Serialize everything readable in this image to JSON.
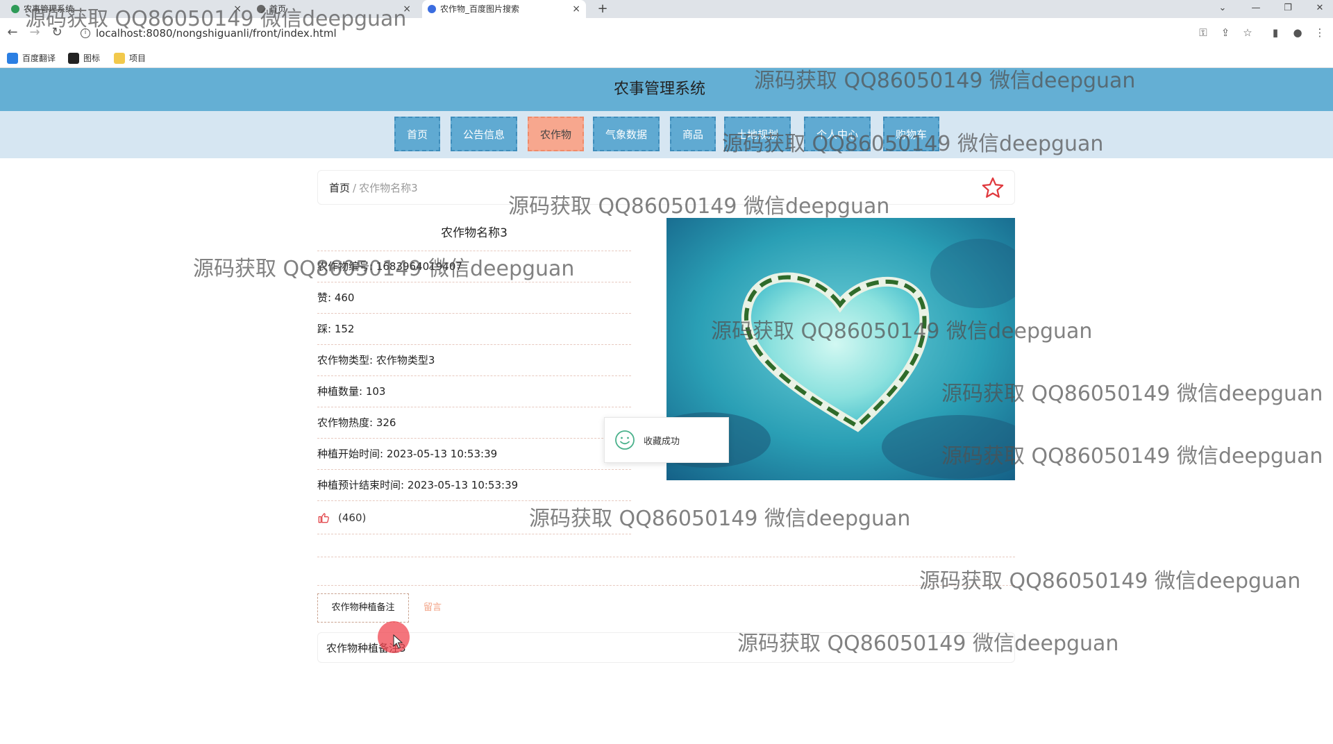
{
  "browser": {
    "tabs": [
      {
        "title": "农事管理系统"
      },
      {
        "title": "首页"
      },
      {
        "title": "农作物_百度图片搜索"
      }
    ],
    "url": "localhost:8080/nongshiguanli/front/index.html",
    "bookmarks": [
      {
        "label": "百度翻译"
      },
      {
        "label": "图标"
      },
      {
        "label": "项目"
      }
    ]
  },
  "site": {
    "title": "农事管理系统",
    "nav": [
      {
        "label": "首页"
      },
      {
        "label": "公告信息"
      },
      {
        "label": "农作物",
        "active": true
      },
      {
        "label": "气象数据"
      },
      {
        "label": "商品"
      },
      {
        "label": "土地规划"
      },
      {
        "label": "个人中心"
      },
      {
        "label": "购物车"
      }
    ]
  },
  "breadcrumb": {
    "home": "首页",
    "separator": "/",
    "current": "农作物名称3"
  },
  "detail": {
    "title": "农作物名称3",
    "rows": [
      {
        "label": "农作物编号",
        "value": "1683964019407"
      },
      {
        "label": "赞",
        "value": "460"
      },
      {
        "label": "踩",
        "value": "152"
      },
      {
        "label": "农作物类型",
        "value": "农作物类型3"
      },
      {
        "label": "种植数量",
        "value": "103"
      },
      {
        "label": "农作物热度",
        "value": "326"
      },
      {
        "label": "种植开始时间",
        "value": "2023-05-13 10:53:39"
      },
      {
        "label": "种植预计结束时间",
        "value": "2023-05-13 10:53:39"
      }
    ],
    "like_count": "(460)"
  },
  "toast": {
    "text": "收藏成功"
  },
  "tabs": {
    "remark_label": "农作物种植备注",
    "message_label": "留言"
  },
  "remark": {
    "text": "农作物种植备注3"
  },
  "watermark": {
    "text": "源码获取 QQ86050149 微信deepguan"
  },
  "colors": {
    "header": "#64afd4",
    "nav_item": "#60aad2",
    "nav_active": "#f7a78e",
    "accent": "#e0393e"
  }
}
